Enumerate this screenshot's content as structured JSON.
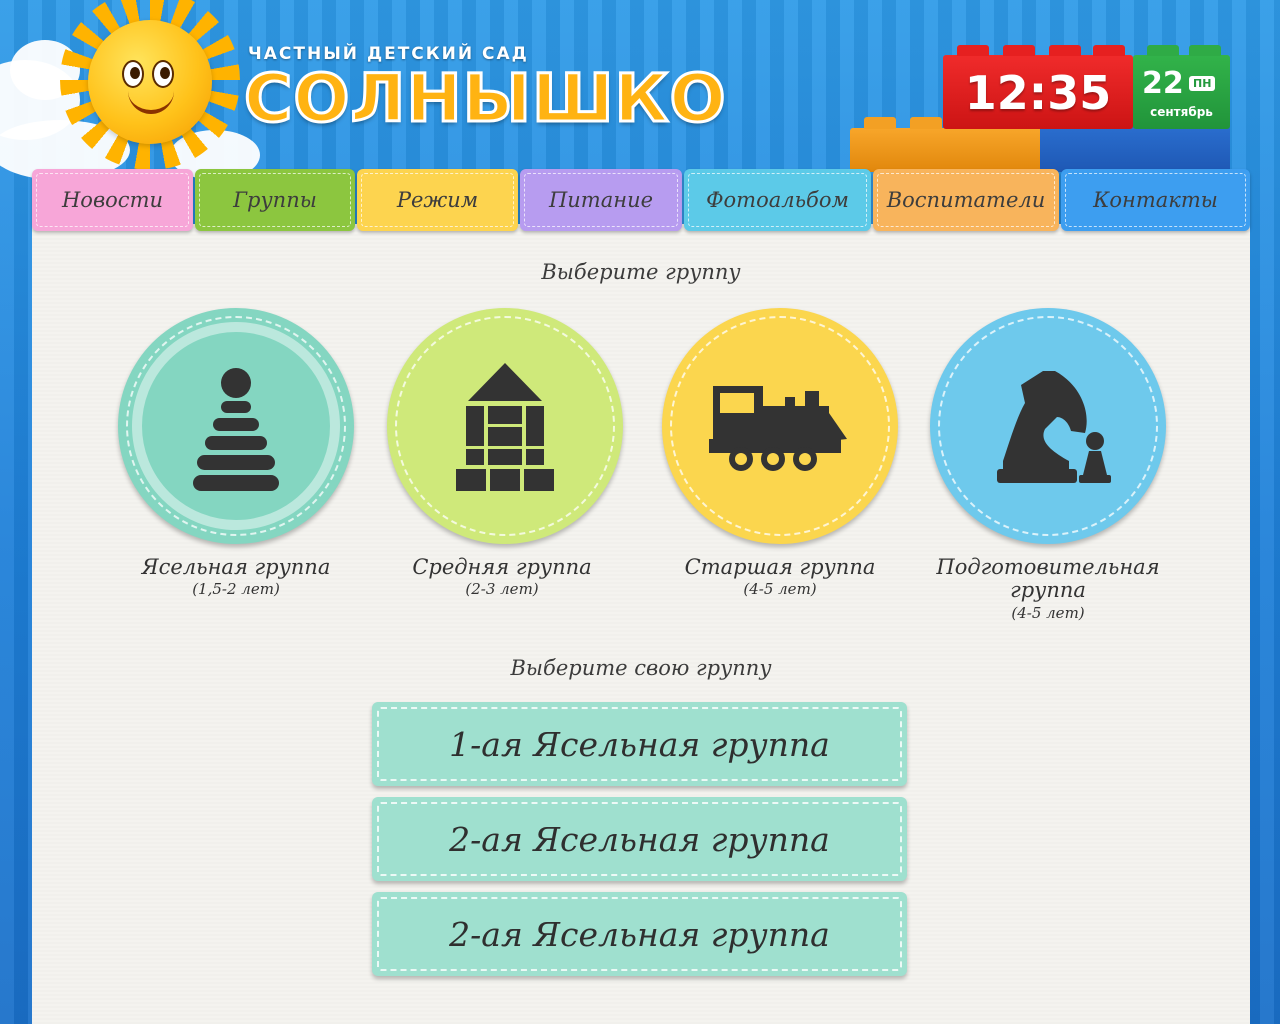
{
  "header": {
    "subtitle": "ЧАСТНЫЙ ДЕТСКИЙ САД",
    "title": "СОЛНЫШКО",
    "clock": {
      "time": "12:35",
      "day": "22",
      "weekday": "ПН",
      "month": "сентябрь"
    }
  },
  "nav": {
    "items": [
      {
        "label": "Новости",
        "color": "#f7a6d8"
      },
      {
        "label": "Группы",
        "color": "#8cc63f"
      },
      {
        "label": "Режим",
        "color": "#fdd44f"
      },
      {
        "label": "Питание",
        "color": "#b79cf0"
      },
      {
        "label": "Фотоальбом",
        "color": "#5ccae8"
      },
      {
        "label": "Воспитатели",
        "color": "#f8b45c"
      },
      {
        "label": "Контакты",
        "color": "#3d9ef0"
      }
    ],
    "active": "Группы"
  },
  "groups_section": {
    "heading": "Выберите группу",
    "groups": [
      {
        "name": "Ясельная группа",
        "age": "(1,5-2 лет)",
        "color": "#84d6c1",
        "icon": "pyramid-toy-icon"
      },
      {
        "name": "Средняя группа",
        "age": "(2-3 лет)",
        "color": "#cfe97a",
        "icon": "blocks-house-icon"
      },
      {
        "name": "Старшая группа",
        "age": "(4-5 лет)",
        "color": "#fbd64e",
        "icon": "train-icon"
      },
      {
        "name": "Подготовительная группа",
        "age": "(4-5 лет)",
        "color": "#6ec9ec",
        "icon": "chess-icon"
      }
    ]
  },
  "own_group_section": {
    "heading": "Выберите свою группу",
    "buttons": [
      {
        "label": "1-ая Ясельная группа"
      },
      {
        "label": "2-ая Ясельная группа"
      },
      {
        "label": "2-ая Ясельная группа"
      }
    ]
  }
}
